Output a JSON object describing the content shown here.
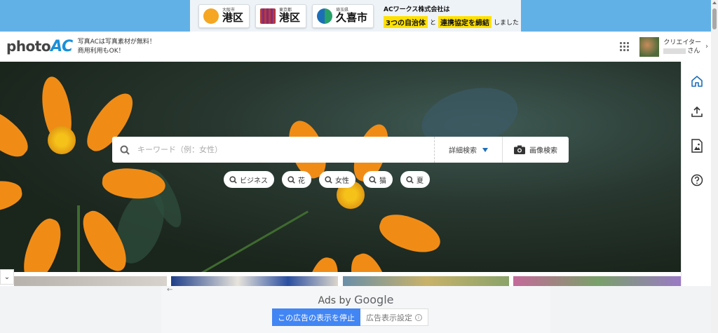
{
  "banner": {
    "cities": [
      {
        "pref": "大阪市",
        "name": "港区",
        "emblem_color": "#f5a623"
      },
      {
        "pref": "東京都",
        "name": "港区",
        "emblem_color": "#c0392b"
      },
      {
        "pref": "埼玉県",
        "name": "久喜市",
        "emblem_color": "#27a06a"
      }
    ],
    "message_line1": "ACワークス株式会社は",
    "message_hl1": "3つの自治体",
    "message_mid": "と",
    "message_hl2": "連携協定を締結",
    "message_end": "しました"
  },
  "header": {
    "logo_text": "photo",
    "logo_accent": "AC",
    "tagline_line1": "写真ACは写真素材が無料！",
    "tagline_line2": "商用利用もOK！",
    "creator_label": "クリエイター",
    "creator_suffix": "さん"
  },
  "search": {
    "placeholder": "キーワード（例：女性）",
    "advanced_label": "詳細検索",
    "image_search_label": "画像検索",
    "tags": [
      "ビジネス",
      "花",
      "女性",
      "猫",
      "夏"
    ]
  },
  "ads": {
    "ads_by": "Ads by",
    "google": "Google",
    "stop_label": "この広告の表示を停止",
    "settings_label": "広告表示設定"
  },
  "colors": {
    "banner_bg": "#62b1e6",
    "accent": "#1a8fd9",
    "ad_button": "#4285f4"
  }
}
